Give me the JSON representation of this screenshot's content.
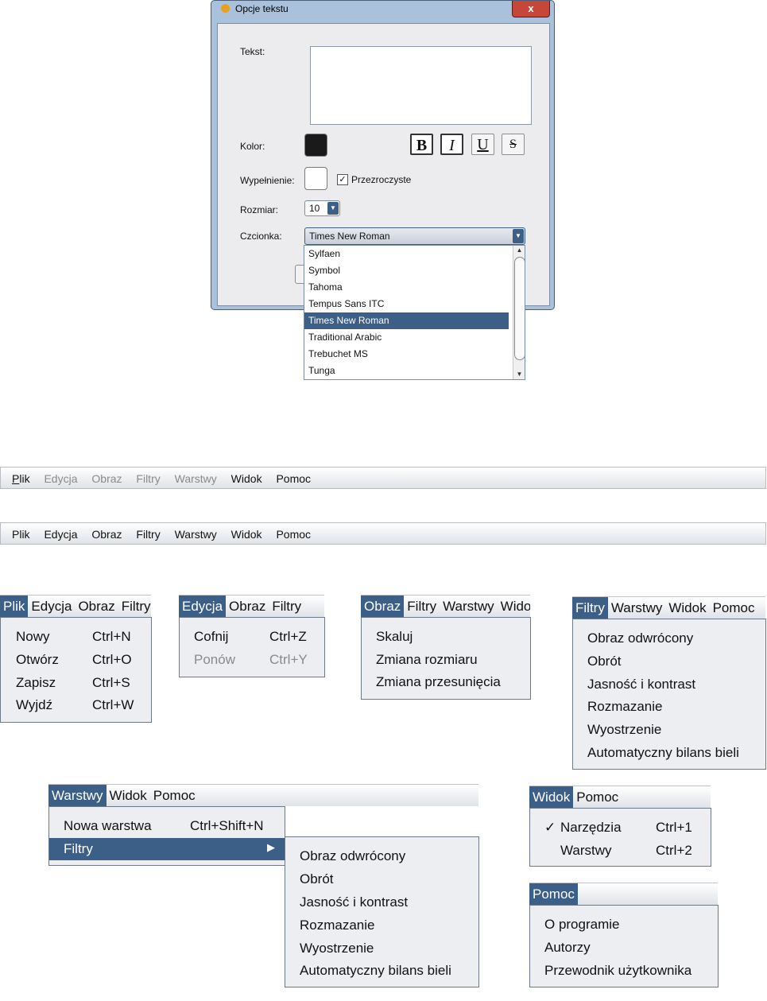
{
  "dialog": {
    "title": "Opcje tekstu",
    "close": "x",
    "labels": {
      "text": "Tekst:",
      "color": "Kolor:",
      "fill": "Wypełnienie:",
      "transparent": "Przezroczyste",
      "size": "Rozmiar:",
      "font": "Czcionka:"
    },
    "format_buttons": [
      "B",
      "I",
      "U",
      "S"
    ],
    "transparent_checked": true,
    "size_value": "10",
    "font_value": "Times New Roman",
    "font_options": [
      "Sylfaen",
      "Symbol",
      "Tahoma",
      "Tempus Sans ITC",
      "Times New Roman",
      "Traditional Arabic",
      "Trebuchet MS",
      "Tunga"
    ],
    "font_selected": "Times New Roman",
    "colors": {
      "text_color": "#1a1a1a",
      "fill_color": "#ffffff",
      "accent": "#3b5f86"
    }
  },
  "menubar": [
    "Plik",
    "Edycja",
    "Obraz",
    "Filtry",
    "Warstwy",
    "Widok",
    "Pomoc"
  ],
  "menus": {
    "plik": {
      "items": [
        {
          "label": "Nowy",
          "shortcut": "Ctrl+N"
        },
        {
          "label": "Otwórz",
          "shortcut": "Ctrl+O"
        },
        {
          "label": "Zapisz",
          "shortcut": "Ctrl+S"
        },
        {
          "label": "Wyjdź",
          "shortcut": "Ctrl+W"
        }
      ]
    },
    "edycja": {
      "items": [
        {
          "label": "Cofnij",
          "shortcut": "Ctrl+Z"
        },
        {
          "label": "Ponów",
          "shortcut": "Ctrl+Y"
        }
      ]
    },
    "obraz": {
      "items": [
        "Skaluj",
        "Zmiana rozmiaru",
        "Zmiana przesunięcia"
      ]
    },
    "filtry": {
      "items": [
        "Obraz odwrócony",
        "Obrót",
        "Jasność i kontrast",
        "Rozmazanie",
        "Wyostrzenie",
        "Automatyczny bilans bieli"
      ]
    },
    "warstwy": {
      "items": [
        {
          "label": "Nowa warstwa",
          "shortcut": "Ctrl+Shift+N"
        },
        {
          "label": "Filtry",
          "submenu_arrow": "▶"
        }
      ],
      "submenu": [
        "Obraz odwrócony",
        "Obrót",
        "Jasność i kontrast",
        "Rozmazanie",
        "Wyostrzenie",
        "Automatyczny bilans bieli"
      ]
    },
    "widok": {
      "items": [
        {
          "label": "Narzędzia",
          "shortcut": "Ctrl+1",
          "check": "✓"
        },
        {
          "label": "Warstwy",
          "shortcut": "Ctrl+2"
        }
      ]
    },
    "pomoc": {
      "items": [
        "O programie",
        "Autorzy",
        "Przewodnik użytkownika"
      ]
    }
  }
}
